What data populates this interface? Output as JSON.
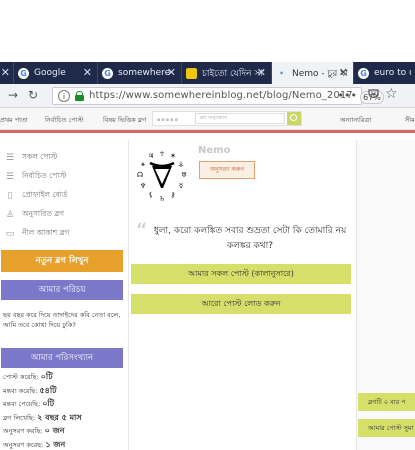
{
  "browser": {
    "tabs": [
      {
        "favicon": "G",
        "label": "Google"
      },
      {
        "favicon": "G",
        "label": "somewhere in..."
      },
      {
        "favicon": "",
        "label": "চাইতো যেদিন সামু"
      },
      {
        "favicon": "•",
        "label": "Nemo - চুর যাবা"
      },
      {
        "favicon": "G",
        "label": "euro to usd"
      }
    ],
    "close_glyph": "✕",
    "url": "https://www.somewhereinblog.net/blog/Nemo_2017",
    "zoom": "67%",
    "menu_glyph": "•••"
  },
  "site_nav": {
    "items": [
      "প্রথম পাতা",
      "নির্বাচিত পোস্ট",
      "বিষয় ভিত্তিক ব্লগ",
      "অন্যান্যরিত্রা",
      "সীম"
    ],
    "search_placeholder": "ব্লগ অনুসন্ধান"
  },
  "sidebar": {
    "menu": [
      {
        "icon": "list-icon",
        "label": "সকল পোস্ট"
      },
      {
        "icon": "list-icon",
        "label": "নির্বাচিত পোস্ট"
      },
      {
        "icon": "document-icon",
        "label": "প্রোফাইল বোর্ড"
      },
      {
        "icon": "person-icon",
        "label": "অনুসারিত ব্লগ"
      },
      {
        "icon": "document-icon",
        "label": "নীল আকাশ ব্লগ"
      }
    ],
    "new_blog_button": "নতুন ব্লগ লিখুন",
    "about_heading": "আমার পরিচয়",
    "about_text": "ছয় বছর করে দিয়ে তাদাইদের কবি নেতা বলে, আমি তবে কোথা দিয়ে ঢুকি?",
    "stats_heading": "আমার পরিসংখ্যান",
    "stats": [
      {
        "label": "পোস্ট করেছি:",
        "value": "০টি"
      },
      {
        "label": "মন্তব্য করেছি:",
        "value": "৫৪টি"
      },
      {
        "label": "মন্তব্য পেয়েছি:",
        "value": "০টি"
      },
      {
        "label": "ব্লগ লিখেছি:",
        "value": "২ বছর ৫ মাস"
      },
      {
        "label": "অনুসরণ করছি:",
        "value": "০ জন"
      },
      {
        "label": "অনুসরণ করেছ:",
        "value": "১ জন"
      }
    ]
  },
  "main": {
    "blog_name": "Nemo",
    "follow_button": "অনুসরণ করুন",
    "quote_mark": "“",
    "quote": "ধুলা, করো কলঙ্কিত সবার শুভ্রতা সেটা কি তোমারি নয় কলঙ্কর কথা?",
    "all_posts_button": "আমার সকল পোস্ট (কালানুসারে)",
    "load_more_button": "আরো পোস্ট লোড করুন"
  },
  "right_column": {
    "button1": "ব্লগটি ০ বার প",
    "button2": "আমার পোস্ট সুমা"
  }
}
